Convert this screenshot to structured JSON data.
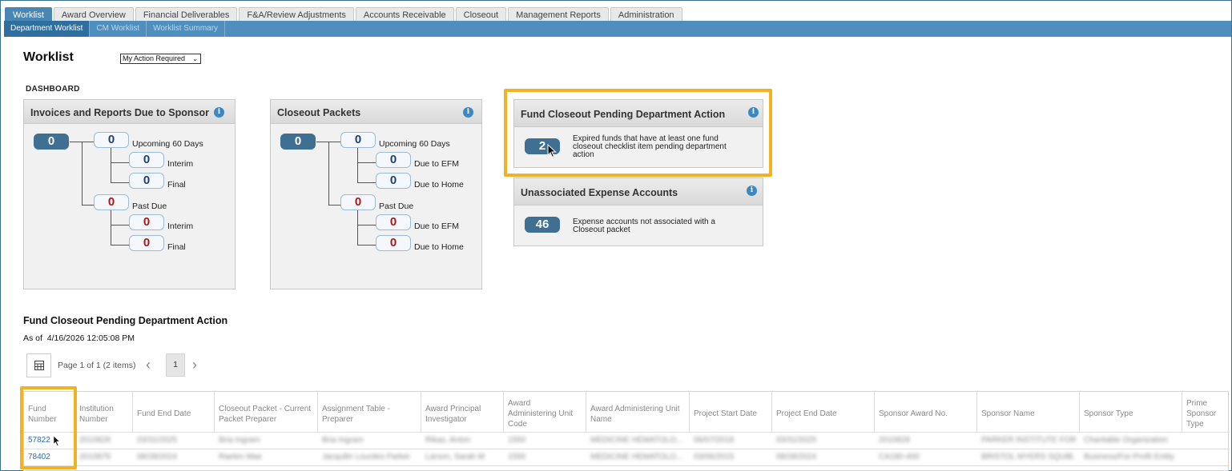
{
  "tabs": [
    "Worklist",
    "Award Overview",
    "Financial Deliverables",
    "F&A/Review Adjustments",
    "Accounts Receivable",
    "Closeout",
    "Management Reports",
    "Administration"
  ],
  "subtabs": [
    "Department Worklist",
    "CM Worklist",
    "Worklist Summary"
  ],
  "page_title": "Worklist",
  "filter_select": "My Action Required",
  "dashboard_label": "DASHBOARD",
  "invoices_panel": {
    "title": "Invoices and Reports Due to Sponsor",
    "root": "0",
    "upcoming": {
      "value": "0",
      "label": "Upcoming 60 Days"
    },
    "upcoming_a": {
      "value": "0",
      "label": "Interim"
    },
    "upcoming_b": {
      "value": "0",
      "label": "Final"
    },
    "past": {
      "value": "0",
      "label": "Past Due"
    },
    "past_a": {
      "value": "0",
      "label": "Interim"
    },
    "past_b": {
      "value": "0",
      "label": "Final"
    }
  },
  "closeout_panel": {
    "title": "Closeout Packets",
    "root": "0",
    "upcoming": {
      "value": "0",
      "label": "Upcoming 60 Days"
    },
    "upcoming_a": {
      "value": "0",
      "label": "Due to EFM"
    },
    "upcoming_b": {
      "value": "0",
      "label": "Due to Home"
    },
    "past": {
      "value": "0",
      "label": "Past Due"
    },
    "past_a": {
      "value": "0",
      "label": "Due to EFM"
    },
    "past_b": {
      "value": "0",
      "label": "Due to Home"
    }
  },
  "fund_closeout_panel": {
    "title": "Fund Closeout Pending Department Action",
    "count": "2",
    "desc_lines": [
      "Expired funds that have at least one fund",
      "closeout checklist item pending department",
      "action"
    ]
  },
  "unassociated_panel": {
    "title": "Unassociated Expense Accounts",
    "count": "46",
    "desc_lines": [
      "Expense accounts not associated with a",
      "Closeout packet"
    ]
  },
  "section": {
    "title": "Fund Closeout Pending Department Action",
    "as_of_label": "As of",
    "as_of_value": "4/16/2026 12:05:08 PM"
  },
  "pager": {
    "text": "Page 1 of 1 (2 items)",
    "current": "1"
  },
  "table": {
    "columns": [
      [
        "Fund",
        "Number"
      ],
      [
        "Institution",
        "Number"
      ],
      [
        "Fund End Date"
      ],
      [
        "Closeout Packet - Current",
        "Packet Preparer"
      ],
      [
        "Assignment Table -",
        "Preparer"
      ],
      [
        "Award Principal",
        "Investigator"
      ],
      [
        "Award",
        "Administering Unit",
        "Code"
      ],
      [
        "Award Administering Unit",
        "Name"
      ],
      [
        "Project Start Date"
      ],
      [
        "Project End Date"
      ],
      [
        "Sponsor Award No."
      ],
      [
        "Sponsor Name"
      ],
      [
        "Sponsor Type"
      ],
      [
        "Prime",
        "Sponsor",
        "Type"
      ]
    ],
    "rows": [
      [
        "57822",
        "2010828",
        "03/31/2025",
        "Bria Ingram",
        "Bria Ingram",
        "Rikas, Anton",
        "1550",
        "MEDICINE HEMATOLO...",
        "06/07/2018",
        "03/31/2025",
        "2010828",
        "PARKER INSTITUTE FOR...",
        "Charitable Organization",
        ""
      ],
      [
        "78402",
        "2010879",
        "08/28/2024",
        "Raelen Mae",
        "Jacquilin Lourdes Parker",
        "Larson, Sarah M",
        "1550",
        "MEDICINE HEMATOLO...",
        "03/06/2015",
        "08/28/2024",
        "CA180-400",
        "BRISTOL MYERS SQUIB...",
        "Business/For-Profit Entity",
        ""
      ]
    ]
  },
  "colors": {
    "tab_active": "#4a86b4",
    "subbar": "#4f8fbd",
    "highlight": "#f0b323",
    "pill_dark": "#3f6f92",
    "past_due_red": "#b01616"
  }
}
